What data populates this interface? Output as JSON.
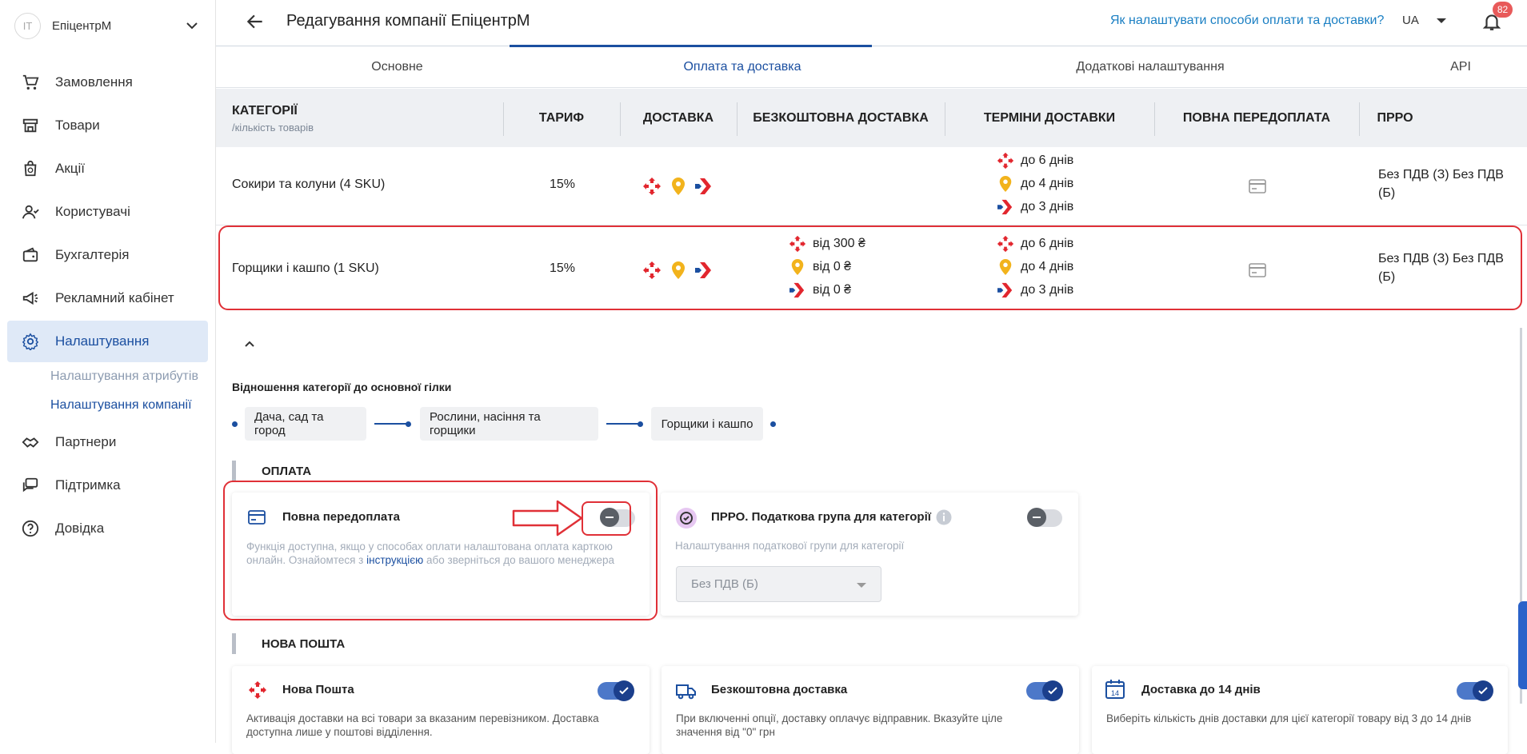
{
  "sidebar": {
    "company": {
      "avatar": "IT",
      "name": "ЕпіцентрМ"
    },
    "items": [
      {
        "label": "Замовлення",
        "icon": "cart-icon"
      },
      {
        "label": "Товари",
        "icon": "store-icon"
      },
      {
        "label": "Акції",
        "icon": "promo-bag-icon"
      },
      {
        "label": "Користувачі",
        "icon": "users-icon"
      },
      {
        "label": "Бухгалтерія",
        "icon": "wallet-icon"
      },
      {
        "label": "Рекламний кабінет",
        "icon": "megaphone-icon"
      },
      {
        "label": "Налаштування",
        "icon": "gear-icon"
      },
      {
        "label": "Партнери",
        "icon": "handshake-icon"
      },
      {
        "label": "Підтримка",
        "icon": "support-chat-icon"
      },
      {
        "label": "Довідка",
        "icon": "help-circle-icon"
      }
    ],
    "subitems": [
      "Налаштування атрибутів",
      "Налаштування компанії"
    ]
  },
  "header": {
    "title": "Редагування компанії ЕпіцентрМ",
    "help_link": "Як налаштувати способи оплати та доставки?",
    "lang": "UA",
    "notifications": "82"
  },
  "tabs": [
    "Основне",
    "Оплата та доставка",
    "Додаткові налаштування",
    "API"
  ],
  "table": {
    "headers": {
      "category": "КАТЕГОРІЇ",
      "category_sub": "/кількість товарів",
      "tariff": "ТАРИФ",
      "delivery": "ДОСТАВКА",
      "free_delivery": "БЕЗКОШТОВНА ДОСТАВКА",
      "terms": "ТЕРМІНИ ДОСТАВКИ",
      "prepay": "ПОВНА ПЕРЕДОПЛАТА",
      "prro": "ПРРО"
    },
    "rows": [
      {
        "category": "Сокири та колуни (4 SKU)",
        "tariff": "15%",
        "free": [],
        "terms": [
          "до 6 днів",
          "до 4 днів",
          "до 3 днів"
        ],
        "prro_line1": "Без ПДВ (З) Без ПДВ",
        "prro_line2": "(Б)"
      },
      {
        "category": "Горщики і кашпо (1 SKU)",
        "tariff": "15%",
        "free": [
          "від 300 ₴",
          "від 0 ₴",
          "від 0 ₴"
        ],
        "terms": [
          "до 6 днів",
          "до 4 днів",
          "до 3 днів"
        ],
        "prro_line1": "Без ПДВ (З) Без ПДВ",
        "prro_line2": "(Б)"
      }
    ]
  },
  "relation": {
    "title": "Відношення категорії до основної гілки",
    "chips": [
      "Дача, сад та город",
      "Рослини, насіння та горщики",
      "Горщики і кашпо"
    ]
  },
  "payment": {
    "section": "ОПЛАТА",
    "prepay_card": {
      "title": "Повна передоплата",
      "desc_before": "Функція доступна, якщо у способах оплати налаштована оплата карткою онлайн. Ознайомтеся з ",
      "link": "інструкцією",
      "desc_after": " або зверніться до вашого менеджера",
      "enabled": false
    },
    "prro_card": {
      "title": "ПРРО. Податкова група для категорії",
      "desc": "Налаштування податкової групи для категорії",
      "select_value": "Без ПДВ (Б)",
      "enabled": false
    }
  },
  "nova": {
    "section": "НОВА ПОШТА",
    "cards": [
      {
        "title": "Нова Пошта",
        "desc": "Активація доставки на всі товари за вказаним перевізником. Доставка доступна лише у поштові відділення.",
        "enabled": true
      },
      {
        "title": "Безкоштовна доставка",
        "desc": "При включенні опції, доставку оплачує відправник. Вказуйте ціле значення від \"0\" грн",
        "enabled": true
      },
      {
        "title": "Доставка до 14 днів",
        "desc": "Виберіть кількість днів доставки для цієї категорії товару від 3 до 14 днів",
        "enabled": true,
        "icon_text": "14"
      }
    ]
  },
  "colors": {
    "accent": "#1b4fa0",
    "highlight": "#e03037",
    "nova_red": "#e2262e",
    "pin_yellow": "#f2b31c",
    "toggle_on": "#1b3f8c"
  }
}
